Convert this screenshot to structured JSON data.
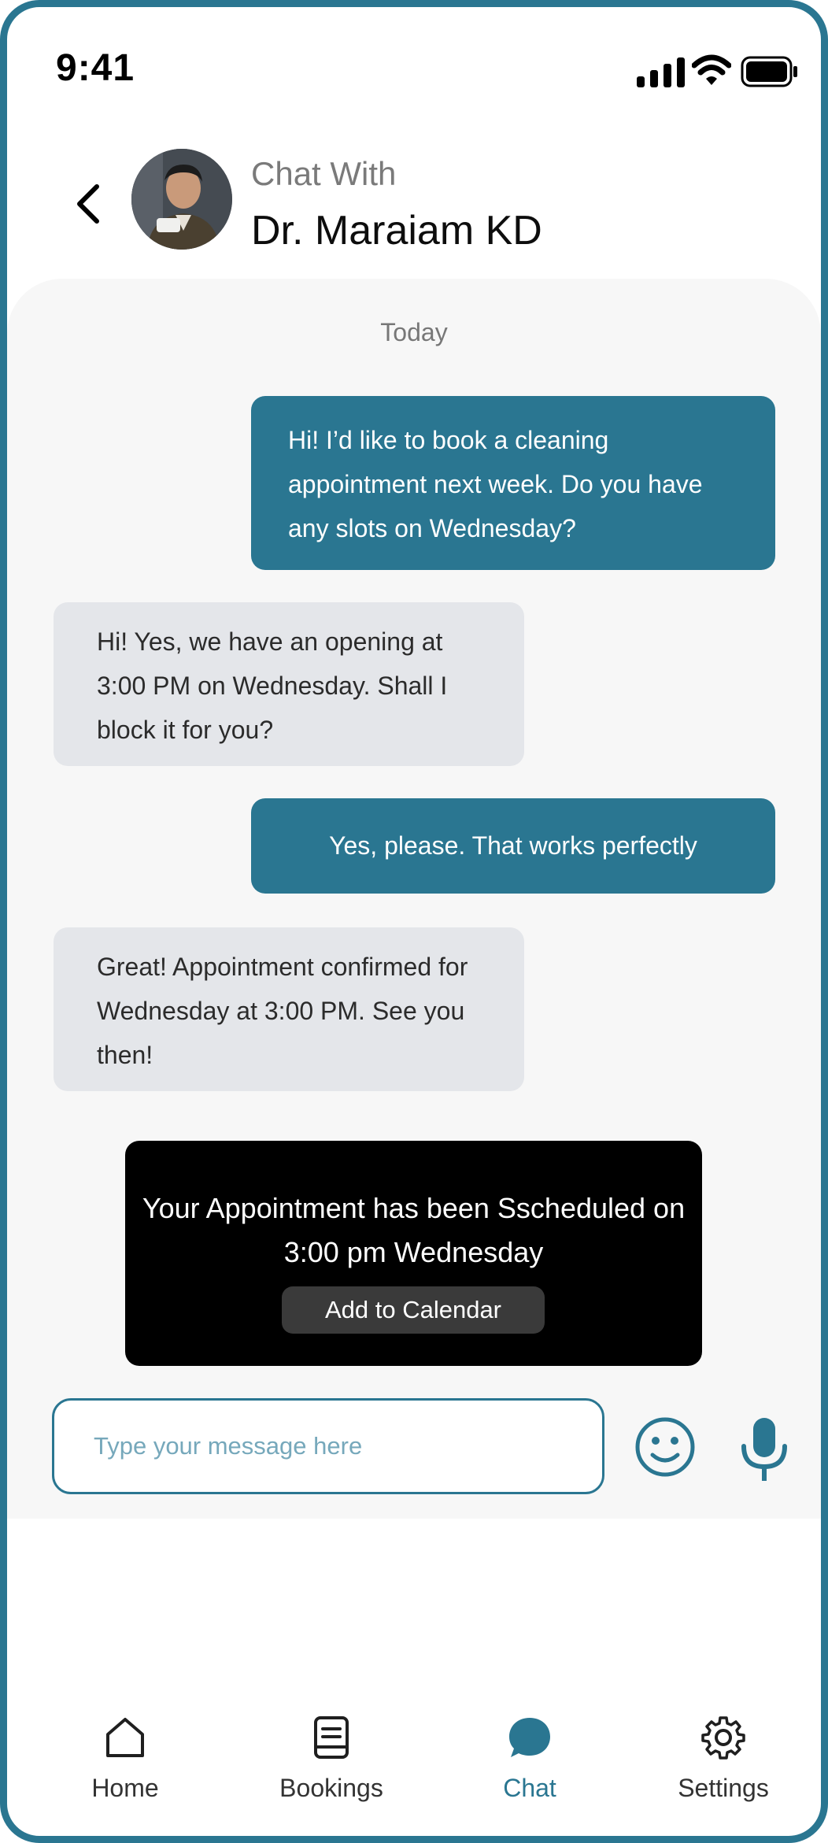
{
  "status_bar": {
    "time": "9:41"
  },
  "header": {
    "subtitle": "Chat With",
    "doctor_name": "Dr. Maraiam KD"
  },
  "chat": {
    "date_divider": "Today",
    "messages": [
      {
        "from": "user",
        "text": "Hi! I’d like to book a cleaning appointment next week. Do you have any slots on Wednesday?"
      },
      {
        "from": "doctor",
        "text": "Hi! Yes, we have an opening at 3:00 PM on Wednesday. Shall I block it for you?"
      },
      {
        "from": "user",
        "text": "Yes, please. That works perfectly"
      },
      {
        "from": "doctor",
        "text": "Great! Appointment confirmed for Wednesday at 3:00 PM. See you then!"
      }
    ],
    "confirmation": {
      "text": "Your Appointment has been Sscheduled on 3:00 pm Wednesday",
      "button_label": "Add to Calendar"
    },
    "input": {
      "placeholder": "Type your message here",
      "value": ""
    }
  },
  "nav": {
    "items": [
      {
        "label": "Home",
        "icon": "home-icon",
        "active": false
      },
      {
        "label": "Bookings",
        "icon": "book-icon",
        "active": false
      },
      {
        "label": "Chat",
        "icon": "chat-bubble-icon",
        "active": true
      },
      {
        "label": "Settings",
        "icon": "gear-icon",
        "active": false
      }
    ]
  },
  "colors": {
    "accent": "#2a7691",
    "received_bubble": "#e4e6ea",
    "chat_background": "#f7f7f7"
  }
}
